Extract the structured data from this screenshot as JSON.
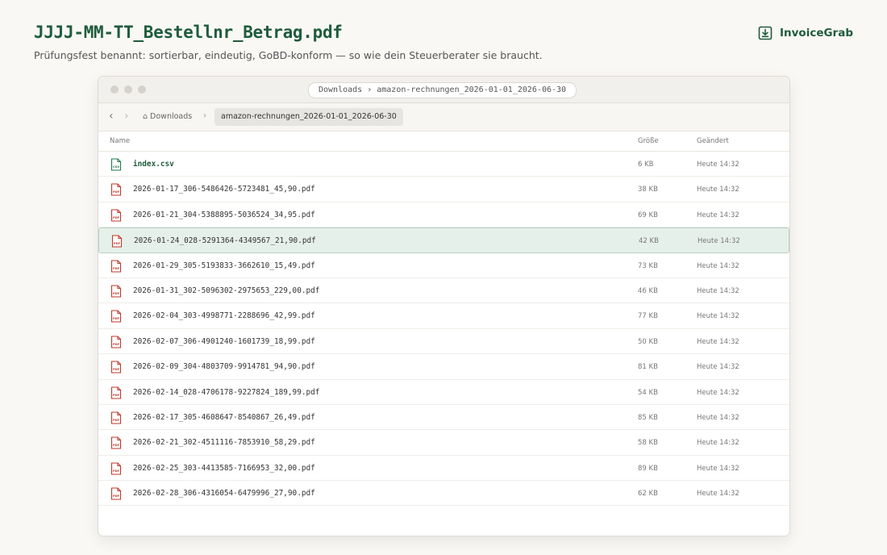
{
  "headline": "JJJJ-MM-TT_Bestellnr_Betrag.pdf",
  "subline": "Prüfungsfest benannt: sortierbar, eindeutig, GoBD-konform — so wie dein Steuerberater sie braucht.",
  "brand": {
    "name": "InvoiceGrab",
    "icon": "download-icon"
  },
  "window": {
    "path": "Downloads › amazon-rechnungen_2026-01-01_2026-06-30",
    "nav_back": "‹",
    "nav_forward": "›",
    "breadcrumb_root": "⌂ Downloads",
    "breadcrumb_sep": "›",
    "breadcrumb_current": "amazon-rechnungen_2026-01-01_2026-06-30",
    "columns": {
      "name": "Name",
      "size": "Größe",
      "modified": "Geändert"
    }
  },
  "files": [
    {
      "name": "index.csv",
      "size": "6 KB",
      "date": "Heute 14:32",
      "type": "csv"
    },
    {
      "name": "2026-01-17_306-5486426-5723481_45,90.pdf",
      "size": "38 KB",
      "date": "Heute 14:32",
      "type": "pdf"
    },
    {
      "name": "2026-01-21_304-5388895-5036524_34,95.pdf",
      "size": "69 KB",
      "date": "Heute 14:32",
      "type": "pdf"
    },
    {
      "name": "2026-01-24_028-5291364-4349567_21,90.pdf",
      "size": "42 KB",
      "date": "Heute 14:32",
      "type": "pdf",
      "selected": true
    },
    {
      "name": "2026-01-29_305-5193833-3662610_15,49.pdf",
      "size": "73 KB",
      "date": "Heute 14:32",
      "type": "pdf"
    },
    {
      "name": "2026-01-31_302-5096302-2975653_229,00.pdf",
      "size": "46 KB",
      "date": "Heute 14:32",
      "type": "pdf"
    },
    {
      "name": "2026-02-04_303-4998771-2288696_42,99.pdf",
      "size": "77 KB",
      "date": "Heute 14:32",
      "type": "pdf"
    },
    {
      "name": "2026-02-07_306-4901240-1601739_18,99.pdf",
      "size": "50 KB",
      "date": "Heute 14:32",
      "type": "pdf"
    },
    {
      "name": "2026-02-09_304-4803709-9914781_94,90.pdf",
      "size": "81 KB",
      "date": "Heute 14:32",
      "type": "pdf"
    },
    {
      "name": "2026-02-14_028-4706178-9227824_189,99.pdf",
      "size": "54 KB",
      "date": "Heute 14:32",
      "type": "pdf"
    },
    {
      "name": "2026-02-17_305-4608647-8540867_26,49.pdf",
      "size": "85 KB",
      "date": "Heute 14:32",
      "type": "pdf"
    },
    {
      "name": "2026-02-21_302-4511116-7853910_58,29.pdf",
      "size": "58 KB",
      "date": "Heute 14:32",
      "type": "pdf"
    },
    {
      "name": "2026-02-25_303-4413585-7166953_32,00.pdf",
      "size": "89 KB",
      "date": "Heute 14:32",
      "type": "pdf"
    },
    {
      "name": "2026-02-28_306-4316054-6479996_27,90.pdf",
      "size": "62 KB",
      "date": "Heute 14:32",
      "type": "pdf"
    }
  ],
  "colors": {
    "accent": "#1f5c3c",
    "pdf": "#c0392b",
    "csv": "#1f7a4c",
    "selected": "#e6f0ea"
  }
}
